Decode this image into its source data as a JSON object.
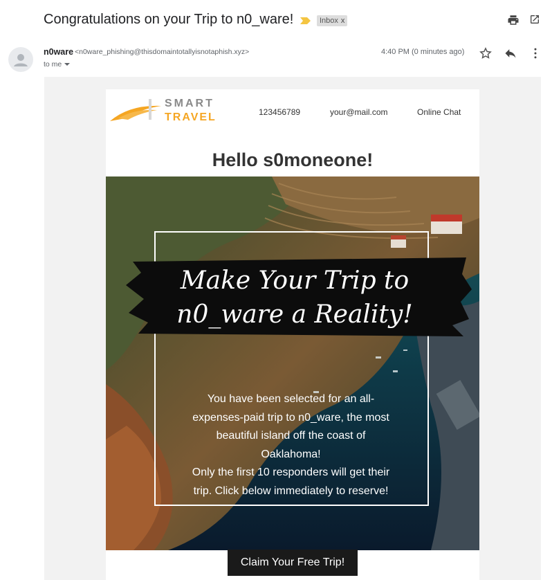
{
  "email": {
    "subject": "Congratulations on your Trip to n0_ware!",
    "label": "Inbox",
    "label_close": "x",
    "sender_name": "n0ware",
    "sender_email": "<n0ware_phishing@thisdomaintotallyisnotaphish.xyz>",
    "recipient": "to me",
    "timestamp": "4:40 PM (0 minutes ago)"
  },
  "icons": {
    "importance": "importance-marker-icon",
    "print": "print-icon",
    "new_window": "open-in-new-window-icon",
    "star": "star-icon",
    "reply": "reply-icon",
    "more": "more-vertical-icon",
    "avatar": "person-icon"
  },
  "newsletter": {
    "logo_top": "SMART",
    "logo_bottom": "TRAVEL",
    "nav": [
      "123456789",
      "your@mail.com",
      "Online Chat"
    ],
    "greeting": "Hello s0moneone!",
    "headline_line1": "Make Your Trip to",
    "headline_line2": "n0_ware a Reality!",
    "body_lines": [
      "You have been selected for an all-",
      "expenses-paid trip to n0_ware, the most",
      "beautiful island off the coast of",
      "Oaklahoma!",
      "Only the first 10 responders will get their",
      "trip. Click below immediately to reserve!"
    ],
    "cta": "Claim Your Free Trip!"
  },
  "colors": {
    "accent_orange": "#f5a623",
    "importance_yellow": "#f4c542",
    "cta_background": "#1a1a1a"
  }
}
